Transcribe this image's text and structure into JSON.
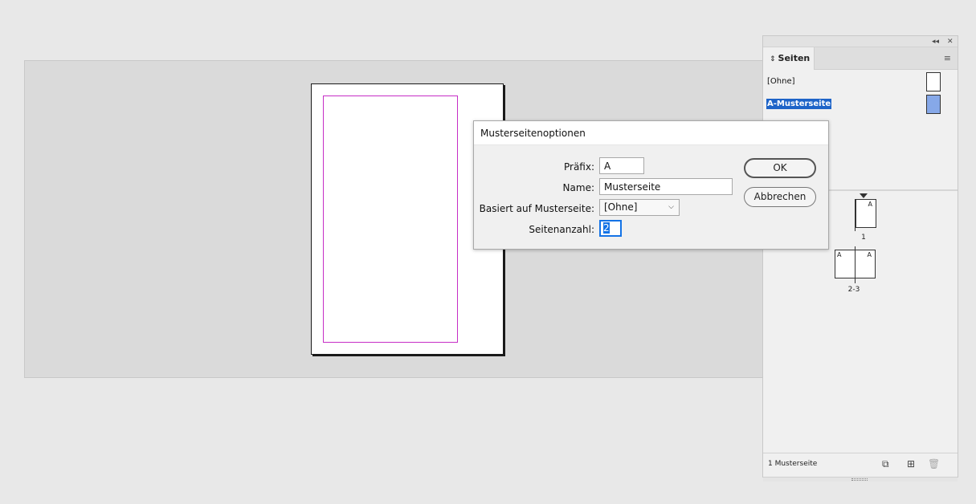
{
  "pages_panel": {
    "tab_label": "Seiten",
    "masters": [
      {
        "label": "[Ohne]",
        "selected": false
      },
      {
        "label": "A-Musterseite",
        "selected": true
      }
    ],
    "spreads": [
      {
        "page_letters": [
          "A"
        ],
        "label": "1"
      },
      {
        "page_letters": [
          "A",
          "A"
        ],
        "label": "2-3"
      }
    ],
    "footer_text": "1 Musterseite"
  },
  "dialog": {
    "title": "Musterseitenoptionen",
    "prefix_label": "Präfix:",
    "prefix_value": "A",
    "name_label": "Name:",
    "name_value": "Musterseite",
    "based_on_label": "Basiert auf Musterseite:",
    "based_on_value": "[Ohne]",
    "page_count_label": "Seitenanzahl:",
    "page_count_value": "2",
    "ok_label": "OK",
    "cancel_label": "Abbrechen"
  },
  "colors": {
    "selection": "#1e64c8",
    "margin_guide": "#c62ec6",
    "focus": "#1473e6"
  },
  "icons": [
    "collapse-icon",
    "close-icon",
    "panel-menu-icon",
    "spinner-icon",
    "new-page-size-icon",
    "new-page-icon",
    "trash-icon",
    "chevron-down-icon"
  ]
}
